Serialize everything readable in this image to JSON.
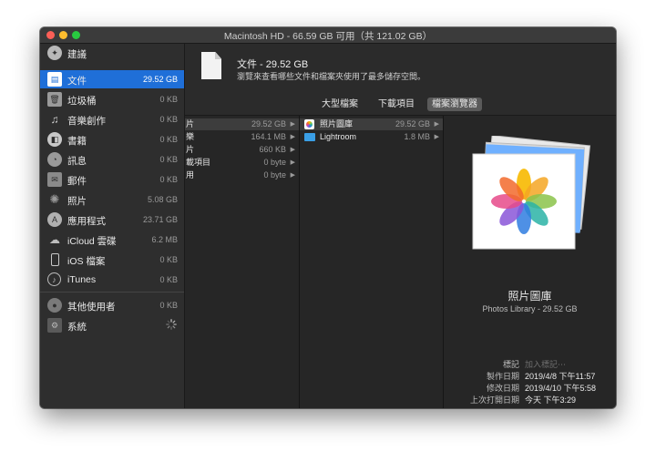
{
  "window": {
    "title": "Macintosh HD - 66.59 GB 可用（共 121.02 GB）"
  },
  "sidebar": {
    "items": [
      {
        "label": "建議",
        "size": ""
      },
      {
        "label": "文件",
        "size": "29.52 GB"
      },
      {
        "label": "垃圾桶",
        "size": "0 KB"
      },
      {
        "label": "音樂創作",
        "size": "0 KB"
      },
      {
        "label": "書籍",
        "size": "0 KB"
      },
      {
        "label": "訊息",
        "size": "0 KB"
      },
      {
        "label": "郵件",
        "size": "0 KB"
      },
      {
        "label": "照片",
        "size": "5.08 GB"
      },
      {
        "label": "應用程式",
        "size": "23.71 GB"
      },
      {
        "label": "iCloud 雲碟",
        "size": "6.2 MB"
      },
      {
        "label": "iOS 檔案",
        "size": "0 KB"
      },
      {
        "label": "iTunes",
        "size": "0 KB"
      },
      {
        "label": "其他使用者",
        "size": "0 KB"
      },
      {
        "label": "系統",
        "size": ""
      }
    ]
  },
  "header": {
    "title": "文件 - 29.52 GB",
    "subtitle": "瀏覽來查看哪些文件和檔案夾使用了最多儲存空間。"
  },
  "tabs": [
    {
      "label": "大型檔案"
    },
    {
      "label": "下載項目"
    },
    {
      "label": "檔案瀏覽器"
    }
  ],
  "column1": [
    {
      "name": "片",
      "size": "29.52 GB"
    },
    {
      "name": "樂",
      "size": "164.1 MB"
    },
    {
      "name": "片",
      "size": "660 KB"
    },
    {
      "name": "載項目",
      "size": "0 byte"
    },
    {
      "name": "用",
      "size": "0 byte"
    }
  ],
  "column2": [
    {
      "name": "照片圖庫",
      "size": "29.52 GB"
    },
    {
      "name": "Lightroom",
      "size": "1.8 MB"
    }
  ],
  "preview": {
    "title": "照片圖庫",
    "subtitle": "Photos Library - 29.52 GB",
    "meta": [
      {
        "key": "標記",
        "value": "加入標記⋯"
      },
      {
        "key": "製作日期",
        "value": "2019/4/8 下午11:57"
      },
      {
        "key": "修改日期",
        "value": "2019/4/10 下午5:58"
      },
      {
        "key": "上次打開日期",
        "value": "今天 下午3:29"
      }
    ]
  },
  "colors": {
    "selection": "#1f6fd8",
    "folder": "#3a9fe6",
    "close": "#fc5f57",
    "minimize": "#fdbc2e",
    "zoom": "#28c840"
  },
  "icons": {
    "sidebar": [
      "lightbulb-icon",
      "document-icon",
      "trash-icon",
      "music-icon",
      "book-icon",
      "message-icon",
      "mail-icon",
      "photos-icon",
      "app-icon",
      "cloud-icon",
      "phone-icon",
      "music-note-icon",
      "users-icon",
      "gear-icon"
    ]
  }
}
